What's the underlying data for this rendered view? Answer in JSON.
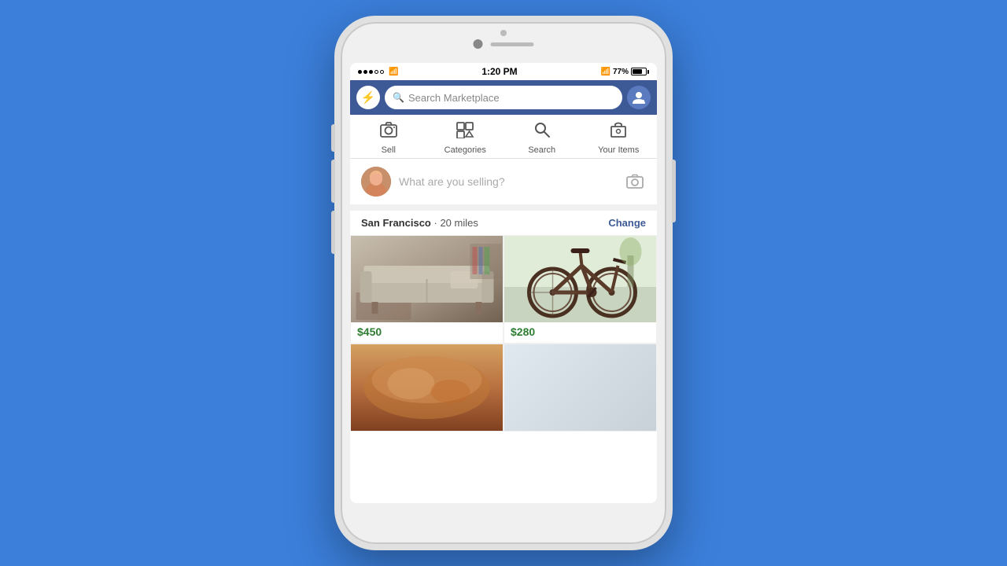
{
  "background": "#3b7fdb",
  "phone": {
    "status_bar": {
      "time": "1:20 PM",
      "battery_percent": "77%",
      "bluetooth": "B",
      "signal_dots": [
        "filled",
        "filled",
        "filled",
        "empty",
        "empty"
      ],
      "wifi": "wifi"
    },
    "top_nav": {
      "search_placeholder": "Search Marketplace",
      "messenger_label": "messenger"
    },
    "tabs": [
      {
        "id": "sell",
        "label": "Sell",
        "icon": "📷"
      },
      {
        "id": "categories",
        "label": "Categories",
        "icon": "⭐"
      },
      {
        "id": "search",
        "label": "Search",
        "icon": "🔍"
      },
      {
        "id": "your-items",
        "label": "Your Items",
        "icon": "📦"
      }
    ],
    "sell_box": {
      "placeholder": "What are you selling?"
    },
    "location": {
      "city": "San Francisco",
      "distance": "20 miles",
      "change_label": "Change"
    },
    "products": [
      {
        "id": "sofa",
        "price": "$450",
        "type": "sofa",
        "alt": "Gray sofa in living room"
      },
      {
        "id": "bike",
        "price": "$280",
        "type": "bike",
        "alt": "Road bicycle"
      },
      {
        "id": "item3",
        "price": "",
        "type": "bread",
        "alt": "Bread or food item"
      },
      {
        "id": "item4",
        "price": "",
        "type": "misc",
        "alt": "Item 4"
      }
    ]
  }
}
